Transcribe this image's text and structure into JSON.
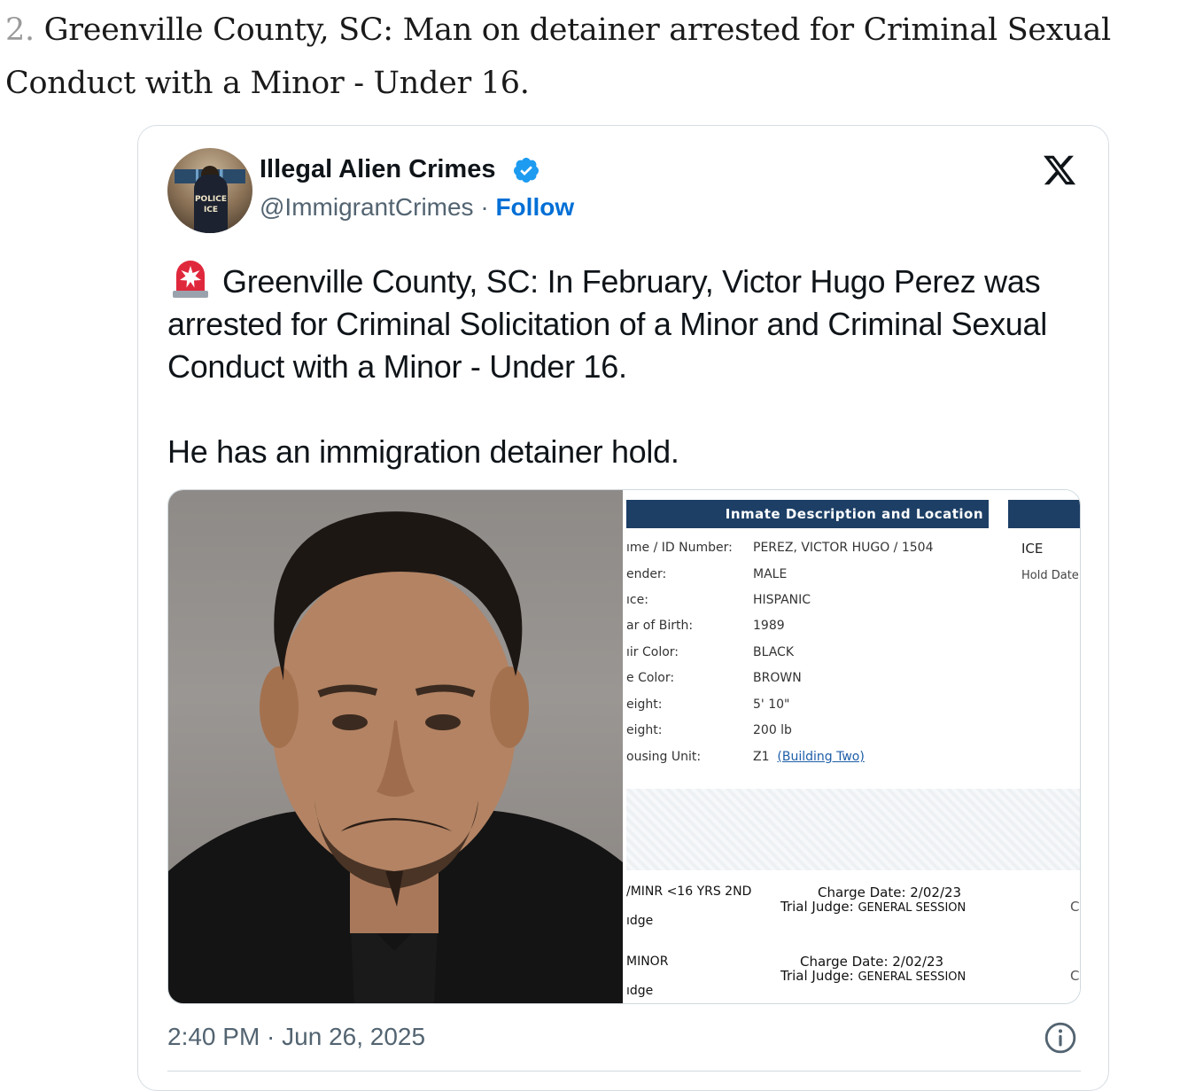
{
  "article": {
    "item_number": "2.",
    "heading": "Greenville County, SC: Man on detainer arrested for Criminal Sexual Conduct with a Minor - Under 16."
  },
  "tweet": {
    "author_name": "Illegal Alien Crimes",
    "handle": "@ImmigrantCrimes",
    "separator": " · ",
    "follow_label": "Follow",
    "avatar_text": "POLICE ICE",
    "text_line1": "Greenville County, SC: In February, Victor Hugo Perez was arrested for Criminal Solicitation of a Minor and Criminal Sexual Conduct with a Minor - Under 16.",
    "text_line2": "He has an immigration detainer hold.",
    "timestamp": "2:40 PM · Jun 26, 2025",
    "icons": {
      "verified": "verified-badge-icon",
      "platform": "x-logo-icon",
      "siren": "siren-emoji-icon",
      "info": "info-icon"
    },
    "colors": {
      "link": "#006fd6",
      "verified": "#1d9bf0",
      "muted": "#536471",
      "doc_header": "#1d3f66"
    }
  },
  "inmate_doc": {
    "header": "Inmate Description and Location",
    "fields": [
      {
        "label": "ıme / ID Number:",
        "value": "PEREZ, VICTOR HUGO / 1504"
      },
      {
        "label": "ender:",
        "value": "MALE"
      },
      {
        "label": "ıce:",
        "value": "HISPANIC"
      },
      {
        "label": "ar of Birth:",
        "value": "1989"
      },
      {
        "label": "ıir Color:",
        "value": "BLACK"
      },
      {
        "label": "e Color:",
        "value": "BROWN"
      },
      {
        "label": "eight:",
        "value": "5' 10\""
      },
      {
        "label": "eight:",
        "value": "200 lb"
      },
      {
        "label": "ousing Unit:",
        "value": "Z1"
      }
    ],
    "housing_link": "(Building Two)",
    "side_label": "ICE",
    "side_sub": "Hold Date",
    "charges": [
      {
        "charge": "/MINR <16 YRS 2ND",
        "sub": "ıdge",
        "charge_date": "Charge Date: 2/02/23",
        "judge_label": "Trial Judge:",
        "judge_value": "GENERAL SESSION",
        "edge": "C"
      },
      {
        "charge": "MINOR",
        "sub": "ıdge",
        "charge_date": "Charge Date: 2/02/23",
        "judge_label": "Trial Judge:",
        "judge_value": "GENERAL SESSION",
        "edge": "C"
      }
    ]
  }
}
